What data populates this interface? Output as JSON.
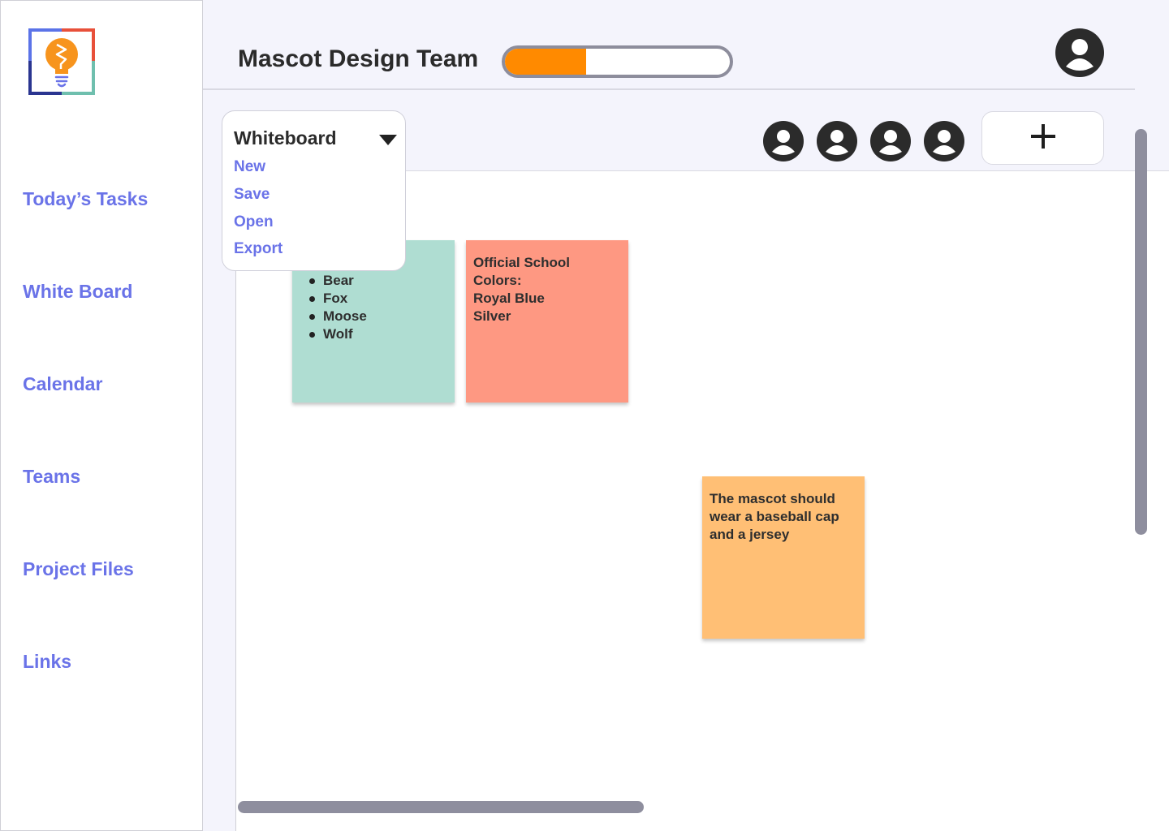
{
  "app": {
    "brand_colors": {
      "accent": "#6a73e8",
      "progress": "#ff8a00",
      "logo_orange": "#f7941d"
    }
  },
  "sidebar": {
    "items": [
      {
        "label": "Today’s Tasks"
      },
      {
        "label": "White Board"
      },
      {
        "label": "Calendar"
      },
      {
        "label": "Teams"
      },
      {
        "label": "Project Files"
      },
      {
        "label": "Links"
      }
    ]
  },
  "header": {
    "title": "Mascot Design Team",
    "progress_percent": 36,
    "user_icon": "user-avatar-icon"
  },
  "toolbar": {
    "team_members": [
      "member-avatar-icon",
      "member-avatar-icon",
      "member-avatar-icon",
      "member-avatar-icon"
    ],
    "add_icon": "plus-icon"
  },
  "whiteboard_menu": {
    "title": "Whiteboard",
    "items": [
      "New",
      "Save",
      "Open",
      "Export"
    ]
  },
  "notes": {
    "green": {
      "color": "#afddd2",
      "items": [
        "Bear",
        "Fox",
        "Moose",
        "Wolf"
      ]
    },
    "red": {
      "color": "#fe9882",
      "lines": [
        "Official School Colors:",
        "Royal Blue",
        "Silver"
      ]
    },
    "orange": {
      "color": "#ffbf75",
      "lines": [
        "The mascot should",
        "wear a baseball cap",
        "and a jersey"
      ]
    }
  }
}
